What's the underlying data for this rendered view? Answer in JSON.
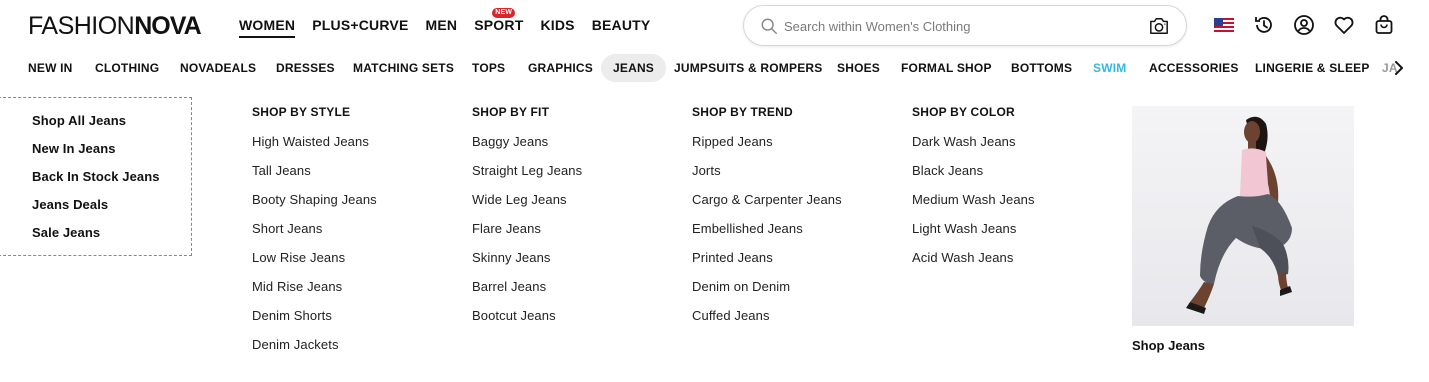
{
  "logo": {
    "part1": "FASHION",
    "part2": "NOVA"
  },
  "topnav": [
    {
      "label": "WOMEN",
      "active": true
    },
    {
      "label": "PLUS+CURVE"
    },
    {
      "label": "MEN"
    },
    {
      "label": "SPORT",
      "badge": "NEW"
    },
    {
      "label": "KIDS"
    },
    {
      "label": "BEAUTY"
    }
  ],
  "search": {
    "placeholder": "Search within Women's Clothing"
  },
  "utilities": [
    "us-flag-icon",
    "history-icon",
    "account-icon",
    "wishlist-heart-icon",
    "shopping-bag-icon"
  ],
  "categories": [
    "NEW IN",
    "CLOTHING",
    "NOVADEALS",
    "DRESSES",
    "MATCHING SETS",
    "TOPS",
    "GRAPHICS",
    "JEANS",
    "JUMPSUITS & ROMPERS",
    "SHOES",
    "FORMAL SHOP",
    "BOTTOMS",
    "SWIM",
    "ACCESSORIES",
    "LINGERIE & SLEEP",
    "JA"
  ],
  "active_category": "JEANS",
  "colors": {
    "swim": "#35b9e0",
    "badge": "#d9252c",
    "active_pill": "#ececec"
  },
  "dropdown": {
    "quick_links": [
      "Shop All Jeans",
      "New In Jeans",
      "Back In Stock Jeans",
      "Jeans Deals",
      "Sale Jeans"
    ],
    "columns": [
      {
        "title": "SHOP BY STYLE",
        "links": [
          "High Waisted Jeans",
          "Tall Jeans",
          "Booty Shaping Jeans",
          "Short Jeans",
          "Low Rise Jeans",
          "Mid Rise Jeans",
          "Denim Shorts",
          "Denim Jackets"
        ]
      },
      {
        "title": "SHOP BY FIT",
        "links": [
          "Baggy Jeans",
          "Straight Leg Jeans",
          "Wide Leg Jeans",
          "Flare Jeans",
          "Skinny Jeans",
          "Barrel Jeans",
          "Bootcut Jeans"
        ]
      },
      {
        "title": "SHOP BY TREND",
        "links": [
          "Ripped Jeans",
          "Jorts",
          "Cargo & Carpenter Jeans",
          "Embellished Jeans",
          "Printed Jeans",
          "Denim on Denim",
          "Cuffed Jeans"
        ]
      },
      {
        "title": "SHOP BY COLOR",
        "links": [
          "Dark Wash Jeans",
          "Black Jeans",
          "Medium Wash Jeans",
          "Light Wash Jeans",
          "Acid Wash Jeans"
        ]
      }
    ],
    "promo": {
      "caption": "Shop Jeans"
    }
  }
}
